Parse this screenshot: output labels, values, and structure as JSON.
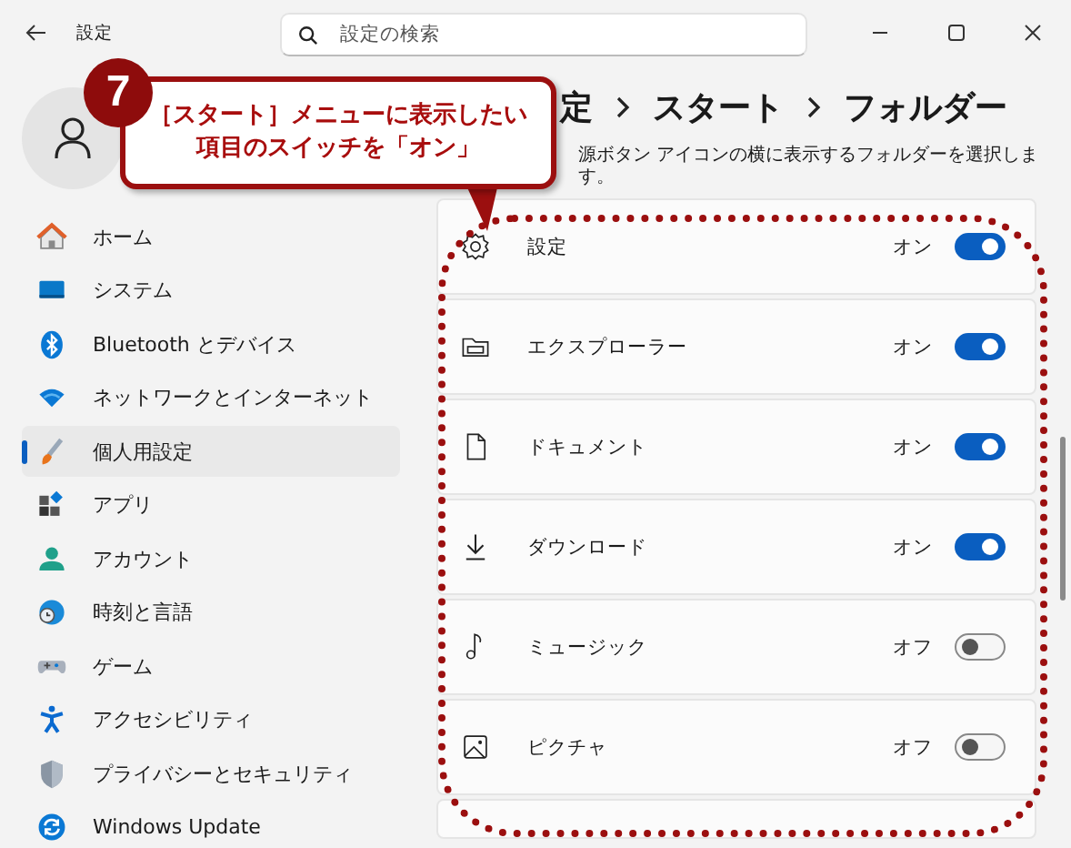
{
  "window": {
    "title": "設定"
  },
  "search": {
    "placeholder": "設定の検索"
  },
  "breadcrumb": [
    "定",
    "スタート",
    "フォルダー"
  ],
  "description": "源ボタン アイコンの横に表示するフォルダーを選択します。",
  "sidebar": {
    "items": [
      {
        "label": "ホーム",
        "selected": false
      },
      {
        "label": "システム",
        "selected": false
      },
      {
        "label": "Bluetooth とデバイス",
        "selected": false
      },
      {
        "label": "ネットワークとインターネット",
        "selected": false
      },
      {
        "label": "個人用設定",
        "selected": true
      },
      {
        "label": "アプリ",
        "selected": false
      },
      {
        "label": "アカウント",
        "selected": false
      },
      {
        "label": "時刻と言語",
        "selected": false
      },
      {
        "label": "ゲーム",
        "selected": false
      },
      {
        "label": "アクセシビリティ",
        "selected": false
      },
      {
        "label": "プライバシーとセキュリティ",
        "selected": false
      },
      {
        "label": "Windows Update",
        "selected": false
      }
    ]
  },
  "folders": [
    {
      "label": "設定",
      "state": "オン",
      "on": true
    },
    {
      "label": "エクスプローラー",
      "state": "オン",
      "on": true
    },
    {
      "label": "ドキュメント",
      "state": "オン",
      "on": true
    },
    {
      "label": "ダウンロード",
      "state": "オン",
      "on": true
    },
    {
      "label": "ミュージック",
      "state": "オフ",
      "on": false
    },
    {
      "label": "ピクチャ",
      "state": "オフ",
      "on": false
    }
  ],
  "callout": {
    "number": "7",
    "lines": [
      "［スタート］メニューに表示したい",
      "項目のスイッチを「オン」"
    ]
  }
}
